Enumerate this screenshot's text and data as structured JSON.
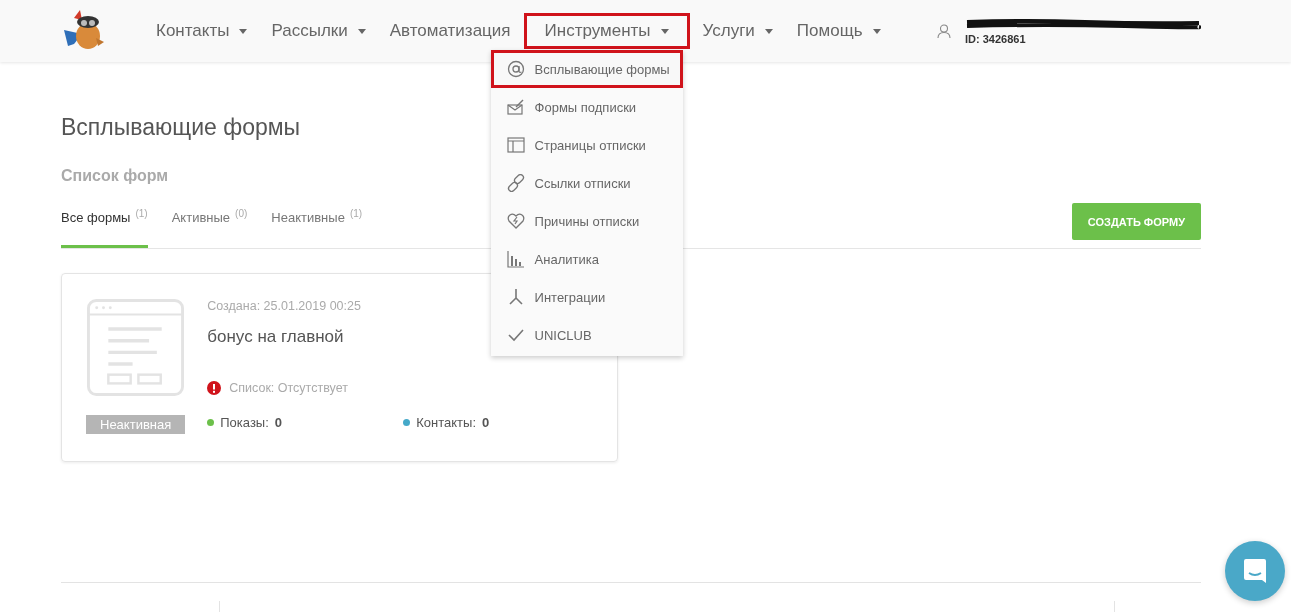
{
  "nav": {
    "items": [
      {
        "label": "Контакты",
        "dropdown": true,
        "highlighted": false
      },
      {
        "label": "Рассылки",
        "dropdown": true,
        "highlighted": false
      },
      {
        "label": "Автоматизация",
        "dropdown": false,
        "highlighted": false
      },
      {
        "label": "Инструменты",
        "dropdown": true,
        "highlighted": true
      },
      {
        "label": "Услуги",
        "dropdown": true,
        "highlighted": false
      },
      {
        "label": "Помощь",
        "dropdown": true,
        "highlighted": false
      }
    ],
    "account_id": "ID: 3426861"
  },
  "menu": {
    "items": [
      {
        "label": "Всплывающие формы",
        "highlighted": true
      },
      {
        "label": "Формы подписки",
        "highlighted": false
      },
      {
        "label": "Страницы отписки",
        "highlighted": false
      },
      {
        "label": "Ссылки отписки",
        "highlighted": false
      },
      {
        "label": "Причины отписки",
        "highlighted": false
      },
      {
        "label": "Аналитика",
        "highlighted": false
      },
      {
        "label": "Интеграции",
        "highlighted": false
      },
      {
        "label": "UNICLUB",
        "highlighted": false
      }
    ]
  },
  "page": {
    "title": "Всплывающие формы",
    "subtitle": "Список форм"
  },
  "tabs": [
    {
      "label": "Все формы",
      "count": "(1)",
      "selected": true
    },
    {
      "label": "Активные",
      "count": "(0)",
      "selected": false
    },
    {
      "label": "Неактивные",
      "count": "(1)",
      "selected": false
    }
  ],
  "create_button": "СОЗДАТЬ ФОРМУ",
  "cards": [
    {
      "created": "Создана: 25.01.2019 00:25",
      "name": "бонус на главной",
      "status": "Неактивная",
      "list_warning": "Список: Отсутствует",
      "stats": [
        {
          "label": "Показы:",
          "value": "0",
          "color": "#6cc04a"
        },
        {
          "label": "Контакты:",
          "value": "0",
          "color": "#45a9c9"
        }
      ]
    }
  ]
}
